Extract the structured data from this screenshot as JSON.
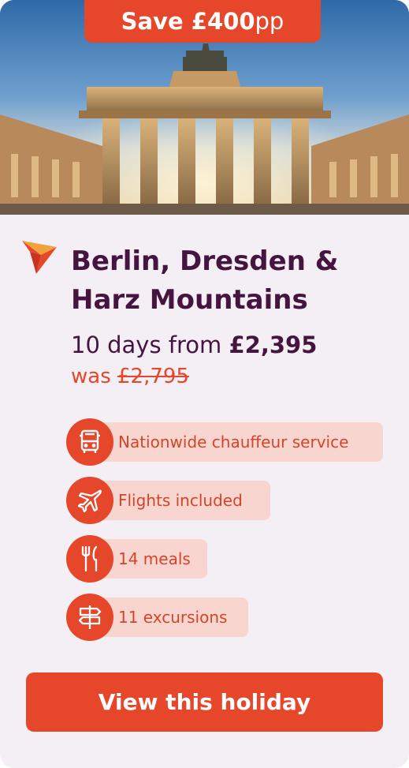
{
  "badge": {
    "save_strong": "Save £400",
    "save_suffix": "pp"
  },
  "hero": {
    "image": "Brandenburg Gate at sunset"
  },
  "holiday": {
    "title_line1": "Berlin, Dresden &",
    "title_line2": "Harz Mountains",
    "duration_prefix": "10 days from",
    "price": "£2,395",
    "was_prefix": "was",
    "was_price": "£2,795"
  },
  "features": [
    {
      "icon": "bus-icon",
      "label": "Nationwide chauffeur service"
    },
    {
      "icon": "plane-icon",
      "label": "Flights included"
    },
    {
      "icon": "cutlery-icon",
      "label": "14 meals"
    },
    {
      "icon": "signpost-icon",
      "label": "11 excursions"
    }
  ],
  "cta": {
    "label": "View this holiday"
  },
  "colors": {
    "accent": "#e6472a",
    "title": "#46153f",
    "pill": "#f8d6cf",
    "card": "#f3eff4"
  }
}
